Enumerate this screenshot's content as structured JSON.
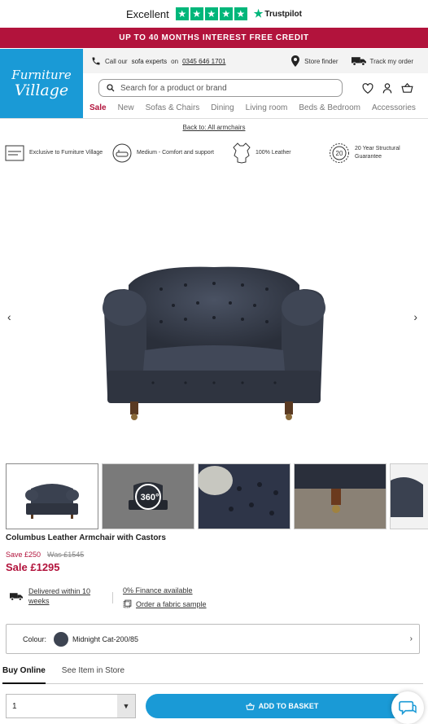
{
  "trustpilot": {
    "rating_text": "Excellent",
    "brand": "Trustpilot",
    "stars": 5,
    "color": "#00b67a"
  },
  "promo": {
    "text": "UP TO 40 MONTHS INTEREST FREE CREDIT",
    "color": "#b2133c"
  },
  "logo": {
    "line1": "Furniture",
    "line2": "Village",
    "color": "#1a9ad6"
  },
  "utility": {
    "call_prefix": "Call our",
    "call_bold": "sofa experts",
    "call_on": "on",
    "phone": "0345 646 1701",
    "store_finder": "Store finder",
    "track_order": "Track my order"
  },
  "search": {
    "placeholder": "Search for a product or brand"
  },
  "nav": [
    "Sale",
    "New",
    "Sofas & Chairs",
    "Dining",
    "Living room",
    "Beds & Bedroom",
    "Accessories"
  ],
  "back_link": "Back to: All armchairs",
  "usps": [
    {
      "icon": "furniture-village-badge-icon",
      "text": "Exclusive to Furniture Village"
    },
    {
      "icon": "seat-cushion-icon",
      "text": "Medium - Comfort and support"
    },
    {
      "icon": "leather-hide-icon",
      "text": "100% Leather"
    },
    {
      "icon": "20-year-badge-icon",
      "text": "20 Year Structural Guarantee"
    }
  ],
  "gallery": {
    "badge_360": "360°"
  },
  "product": {
    "title": "Columbus Leather Armchair with Castors",
    "save": "Save £250",
    "was": "Was £1545",
    "sale_price": "Sale £1295",
    "delivery": "Delivered within 10 weeks",
    "finance": "0% Finance available",
    "fabric_sample": "Order a fabric sample",
    "colour_label": "Colour:",
    "colour_value": "Midnight Cat-200/85",
    "colour_hex": "#3d4452"
  },
  "buy_tabs": [
    "Buy Online",
    "See Item in Store"
  ],
  "quantity": "1",
  "add_to_basket": "ADD TO BASKET"
}
